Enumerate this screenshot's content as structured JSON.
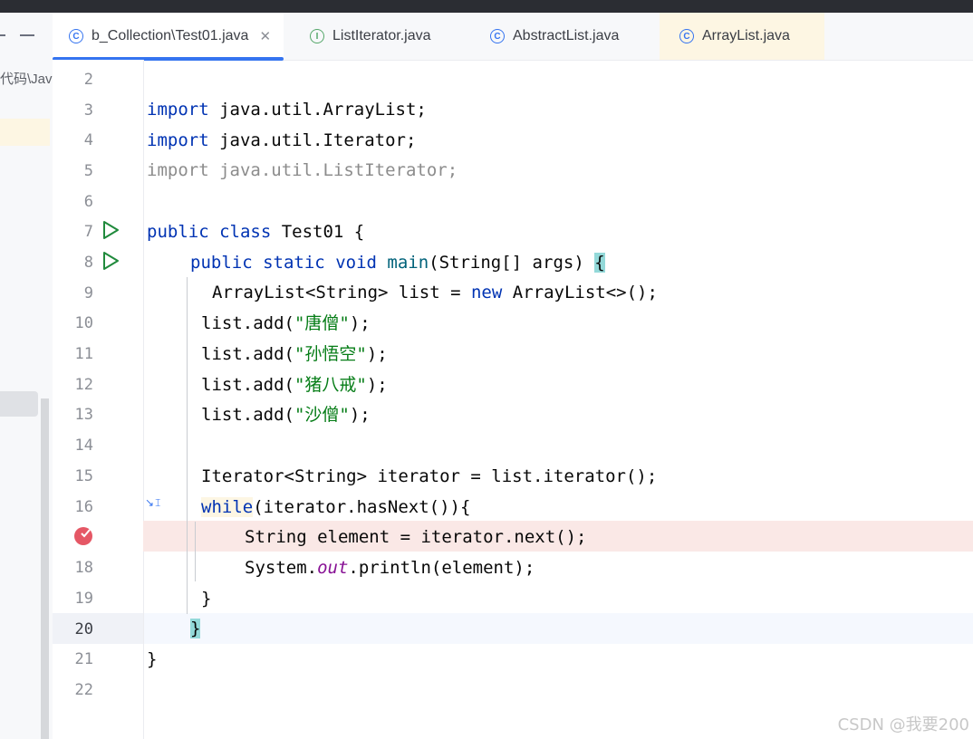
{
  "tabs": [
    {
      "label": "b_Collection\\Test01.java",
      "icon": "class-icon",
      "active": true
    },
    {
      "label": "ListIterator.java",
      "icon": "interface-icon"
    },
    {
      "label": "AbstractList.java",
      "icon": "class-icon"
    },
    {
      "label": "ArrayList.java",
      "icon": "class-icon"
    }
  ],
  "project_panel": {
    "path_fragment": "代码\\Java"
  },
  "gutter": {
    "line_numbers": [
      "2",
      "3",
      "4",
      "5",
      "6",
      "7",
      "8",
      "9",
      "10",
      "11",
      "12",
      "13",
      "14",
      "15",
      "16",
      "17",
      "18",
      "19",
      "20",
      "21",
      "22"
    ],
    "current_line": "20",
    "breakpoint_line": "17"
  },
  "code": {
    "l3": {
      "kw": "import",
      "rest": " java.util.ArrayList;"
    },
    "l4": {
      "kw": "import",
      "rest": " java.util.Iterator;"
    },
    "l5": "import java.util.ListIterator;",
    "l7": {
      "kw1": "public",
      "kw2": "class",
      "rest": " Test01 {"
    },
    "l8": {
      "kw1": "public",
      "kw2": "static",
      "kw3": "void",
      "fn": "main",
      "rest": "(String[] args) ",
      "brace": "{"
    },
    "l9": {
      "a": "ArrayList<String> list = ",
      "kw": "new",
      "b": " ArrayList<>();"
    },
    "l10": {
      "a": "list.add(",
      "s": "\"唐僧\"",
      "b": ");"
    },
    "l11": {
      "a": "list.add(",
      "s": "\"孙悟空\"",
      "b": ");"
    },
    "l12": {
      "a": "list.add(",
      "s": "\"猪八戒\"",
      "b": ");"
    },
    "l13": {
      "a": "list.add(",
      "s": "\"沙僧\"",
      "b": ");"
    },
    "l15": "Iterator<String> iterator = list.iterator();",
    "l16": {
      "kw": "while",
      "rest": "(iterator.hasNext()){"
    },
    "l17": "String element = iterator.next();",
    "l18": {
      "a": "System.",
      "st": "out",
      "b": ".println(element);"
    },
    "l19": "}",
    "l20": "}",
    "l21": "}"
  },
  "watermark": "CSDN @我要200"
}
